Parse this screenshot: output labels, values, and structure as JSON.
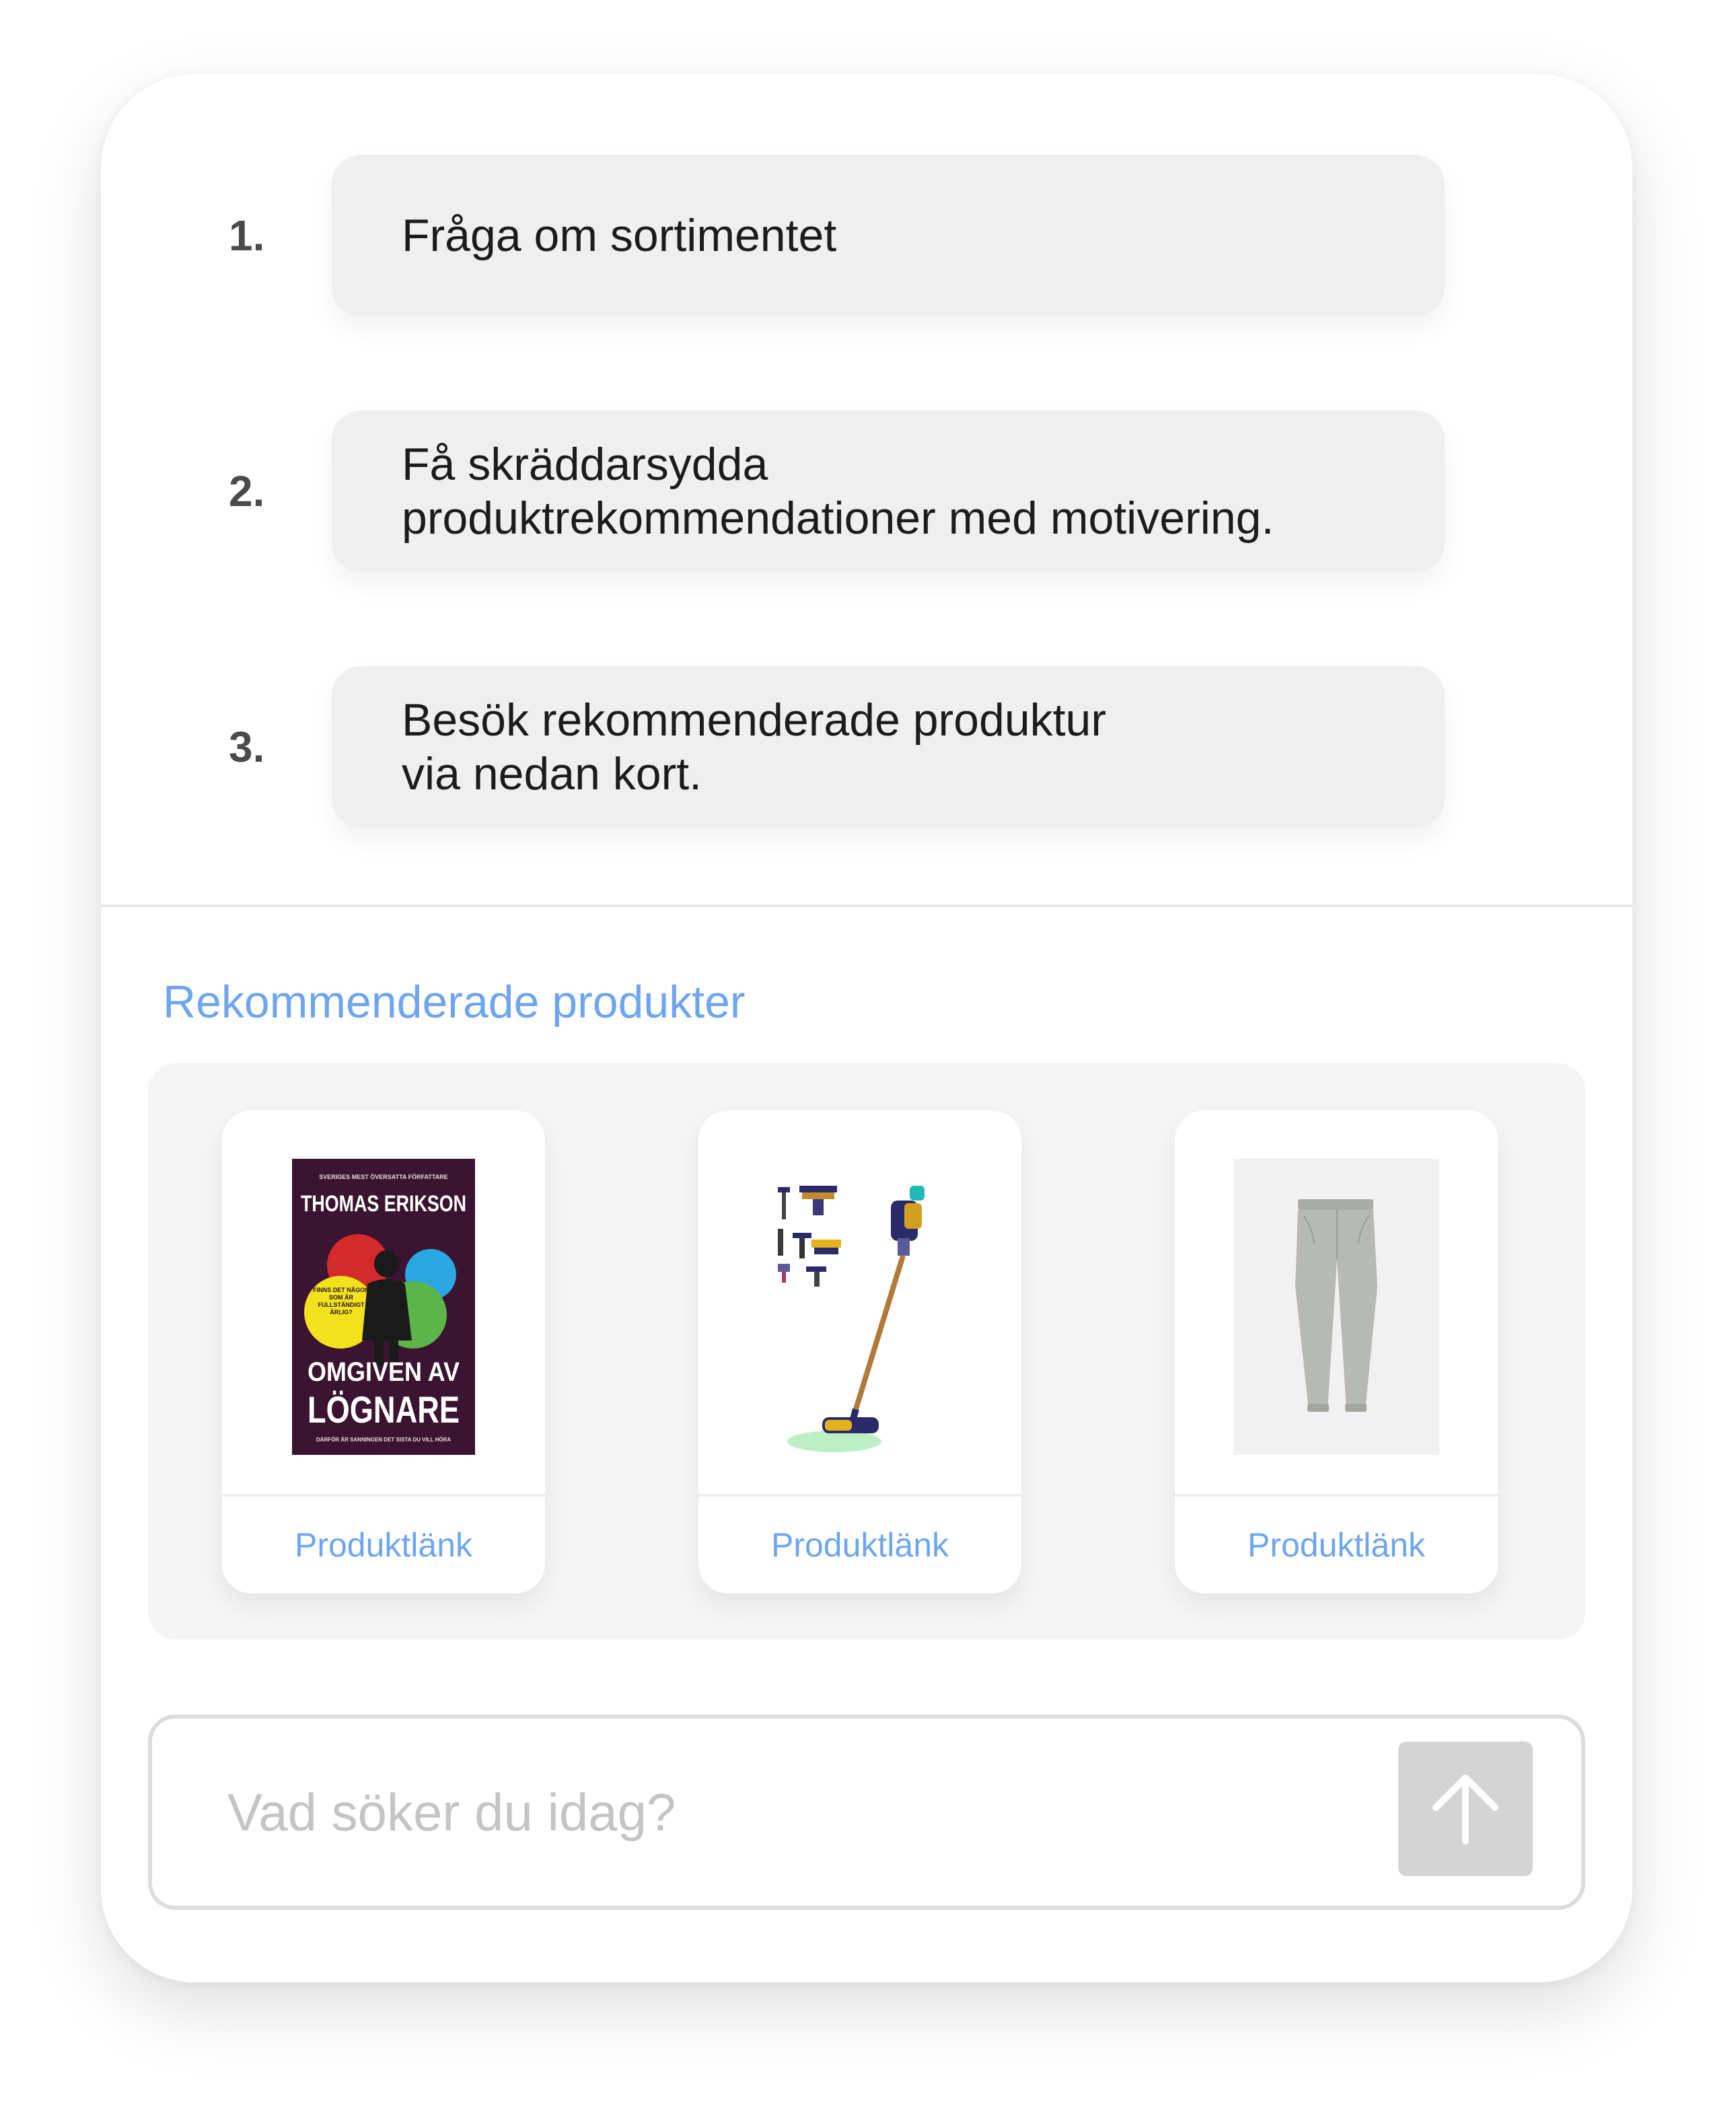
{
  "steps": [
    {
      "number": "1.",
      "text": "Fråga om sortimentet"
    },
    {
      "number": "2.",
      "text": "Få skräddarsydda\nproduktrekommendationer med motivering."
    },
    {
      "number": "3.",
      "text": "Besök rekommenderade produktur\nvia nedan kort."
    }
  ],
  "recommendations": {
    "title": "Rekommenderade produkter",
    "products": [
      {
        "image": "book-cover-image",
        "link_label": "Produktlänk",
        "book": {
          "tagline": "SVERIGES MEST ÖVERSATTA FÖRFATTARE",
          "author": "THOMAS ERIKSON",
          "badge": "FINNS DET NÅGON SOM ÄR FULLSTÄNDIGT ÄRLIG?",
          "title_line1": "OMGIVEN AV",
          "title_line2": "LÖGNARE",
          "subtitle": "DÄRFÖR ÄR SANNINGEN DET SISTA DU VILL HÖRA"
        }
      },
      {
        "image": "vacuum-cleaner-image",
        "link_label": "Produktlänk"
      },
      {
        "image": "chino-pants-image",
        "link_label": "Produktlänk"
      }
    ]
  },
  "search": {
    "placeholder": "Vad söker du idag?",
    "value": "",
    "send_icon": "arrow-up-icon"
  },
  "colors": {
    "accent": "#6ea5f0",
    "bubble": "#efefef",
    "panel": "#f5f5f5",
    "send_button": "#d4d4d4",
    "book_bg": "#3a1430"
  }
}
